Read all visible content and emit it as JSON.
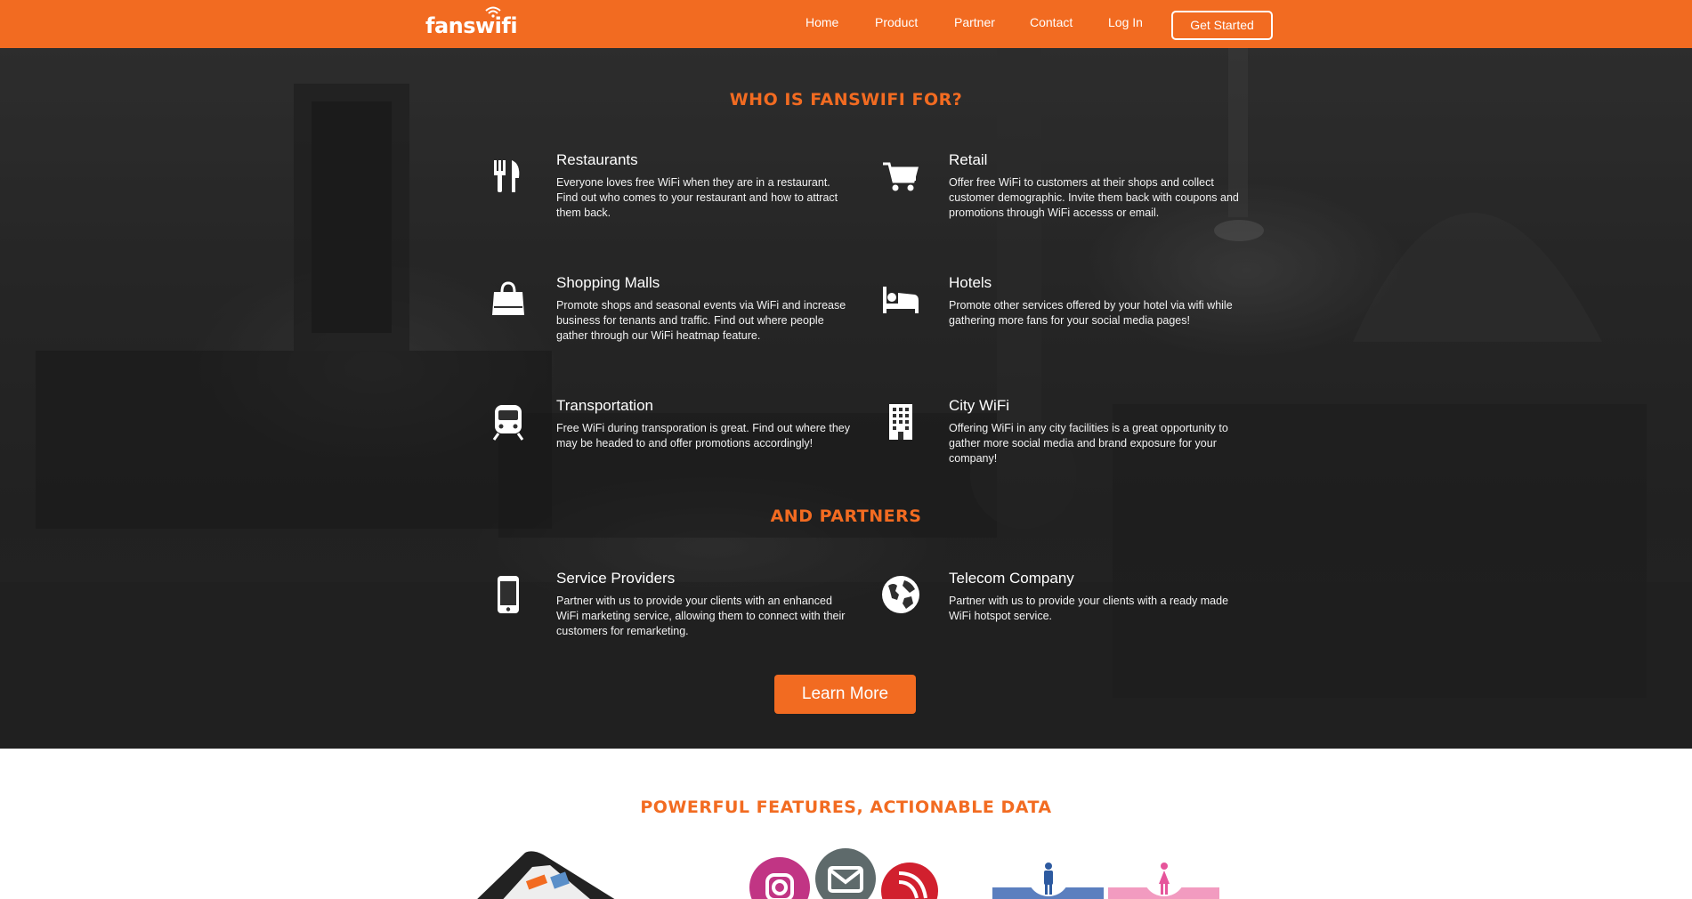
{
  "brand": {
    "logo_text": "fanswifi",
    "accent": "#f26b21"
  },
  "nav": {
    "links": [
      "Home",
      "Product",
      "Partner",
      "Contact",
      "Log In"
    ],
    "cta": "Get Started"
  },
  "who": {
    "heading": "WHO IS FANSWIFI FOR?",
    "items": [
      {
        "icon": "fork-knife-icon",
        "title": "Restaurants",
        "desc": "Everyone loves free WiFi when they are in a restaurant. Find out who comes to your restaurant and how to attract them back."
      },
      {
        "icon": "cart-icon",
        "title": "Retail",
        "desc": "Offer free WiFi to customers at their shops and collect customer demographic. Invite them back with coupons and promotions through WiFi accesss or email."
      },
      {
        "icon": "shopping-bag-icon",
        "title": "Shopping Malls",
        "desc": "Promote shops and seasonal events via WiFi and increase business for tenants and traffic. Find out where people gather through our WiFi heatmap feature."
      },
      {
        "icon": "bed-icon",
        "title": "Hotels",
        "desc": "Promote other services offered by your hotel via wifi while gathering more fans for your social media pages!"
      },
      {
        "icon": "train-icon",
        "title": "Transportation",
        "desc": "Free WiFi during transporation is great. Find out where they may be headed to and offer promotions accordingly!"
      },
      {
        "icon": "building-icon",
        "title": "City WiFi",
        "desc": "Offering WiFi in any city facilities is a great opportunity to gather more social media and brand exposure for your company!"
      }
    ]
  },
  "partners": {
    "heading": "AND PARTNERS",
    "items": [
      {
        "icon": "mobile-phone-icon",
        "title": "Service Providers",
        "desc": "Partner with us to provide your clients with an enhanced WiFi marketing service, allowing them to connect with their customers for remarketing."
      },
      {
        "icon": "globe-icon",
        "title": "Telecom Company",
        "desc": "Partner with us to provide your clients with a ready made WiFi hotspot service."
      }
    ],
    "cta": "Learn More"
  },
  "features": {
    "heading": "POWERFUL FEATURES, ACTIONABLE DATA"
  }
}
